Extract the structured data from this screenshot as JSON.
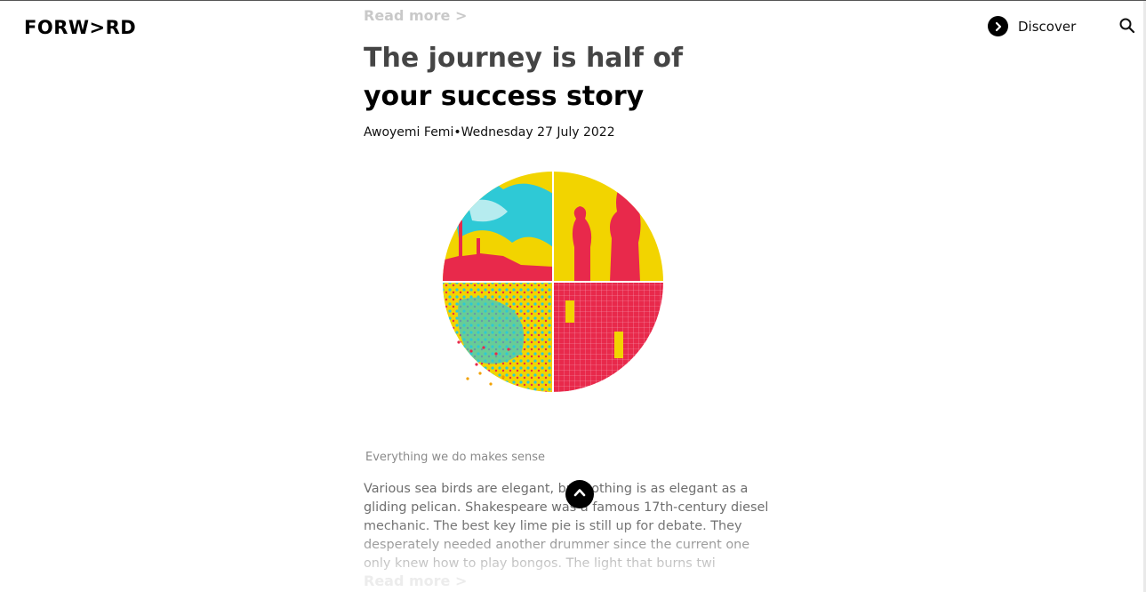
{
  "header": {
    "logo": "FORW>RD",
    "discover_label": "Discover",
    "discover_icon": "chevron-right-circle-icon",
    "search_icon": "search-icon"
  },
  "article": {
    "read_more_top": "Read more >",
    "title": "The journey is half of your success story",
    "byline": "Awoyemi Femi•Wednesday 27 July 2022",
    "hero_image": "circular-collage-illustration",
    "tagline": "Everything we do makes sense",
    "excerpt": "Various sea birds are elegant, but nothing is as elegant as a gliding pelican. Shakespeare was a famous 17th-century diesel mechanic. The best key lime pie is still up for debate. They desperately needed another drummer since the current one only knew how to play bongos. The light that burns twi",
    "read_more_bottom": "Read more >"
  },
  "controls": {
    "scroll_top_icon": "chevron-up-icon"
  },
  "colors": {
    "accent": "#000000",
    "collage_yellow": "#f2d400",
    "collage_red": "#e8294b",
    "collage_cyan": "#2ec9d6"
  }
}
